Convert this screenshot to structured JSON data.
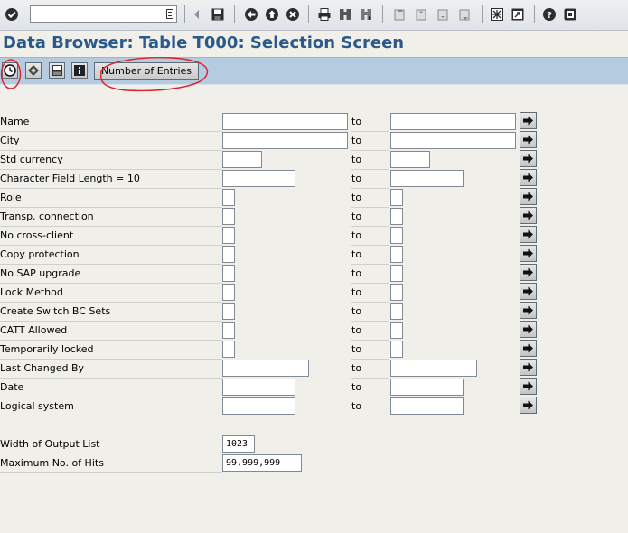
{
  "window": {
    "title": "Data Browser: Table T000: Selection Screen",
    "command_field_value": ""
  },
  "standard_toolbar": {
    "icons": [
      "check-icon",
      "back-arrow-icon",
      "save-icon",
      "back-icon",
      "exit-icon",
      "cancel-icon",
      "print-icon",
      "find-icon",
      "find-next-icon",
      "first-page-icon",
      "previous-page-icon",
      "next-page-icon",
      "last-page-icon",
      "create-session-icon",
      "shortcut-icon",
      "help-icon",
      "customize-layout-icon"
    ]
  },
  "app_toolbar": {
    "execute_icon": "execute-clock-icon",
    "icons": [
      "execute-clock-icon",
      "get-variant-icon",
      "save-variant-icon",
      "info-icon"
    ],
    "count_entries_label": "Number of Entries"
  },
  "to_label": "to",
  "selection_rows": [
    {
      "label": "Name",
      "low": "",
      "high": ""
    },
    {
      "label": "City",
      "low": "",
      "high": ""
    },
    {
      "label": "Std currency",
      "low": "",
      "high": ""
    },
    {
      "label": "Character Field Length = 10",
      "low": "",
      "high": ""
    },
    {
      "label": "Role",
      "low": "",
      "high": ""
    },
    {
      "label": "Transp. connection",
      "low": "",
      "high": ""
    },
    {
      "label": "No cross-client",
      "low": "",
      "high": ""
    },
    {
      "label": "Copy protection",
      "low": "",
      "high": ""
    },
    {
      "label": "No SAP upgrade",
      "low": "",
      "high": ""
    },
    {
      "label": "Lock Method",
      "low": "",
      "high": ""
    },
    {
      "label": "Create Switch BC Sets",
      "low": "",
      "high": ""
    },
    {
      "label": "CATT Allowed",
      "low": "",
      "high": ""
    },
    {
      "label": "Temporarily locked",
      "low": "",
      "high": ""
    },
    {
      "label": "Last Changed By",
      "low": "",
      "high": ""
    },
    {
      "label": "Date",
      "low": "",
      "high": ""
    },
    {
      "label": "Logical system",
      "low": "",
      "high": ""
    }
  ],
  "output_settings": {
    "width_label": "Width of Output List",
    "width_value": "1023",
    "max_hits_label": "Maximum No. of Hits",
    "max_hits_value": "99,999,999"
  },
  "colors": {
    "title": "#2b5a8a",
    "app_toolbar": "#b5cbe0",
    "background": "#f0efe9",
    "annotation": "#e0202a"
  }
}
